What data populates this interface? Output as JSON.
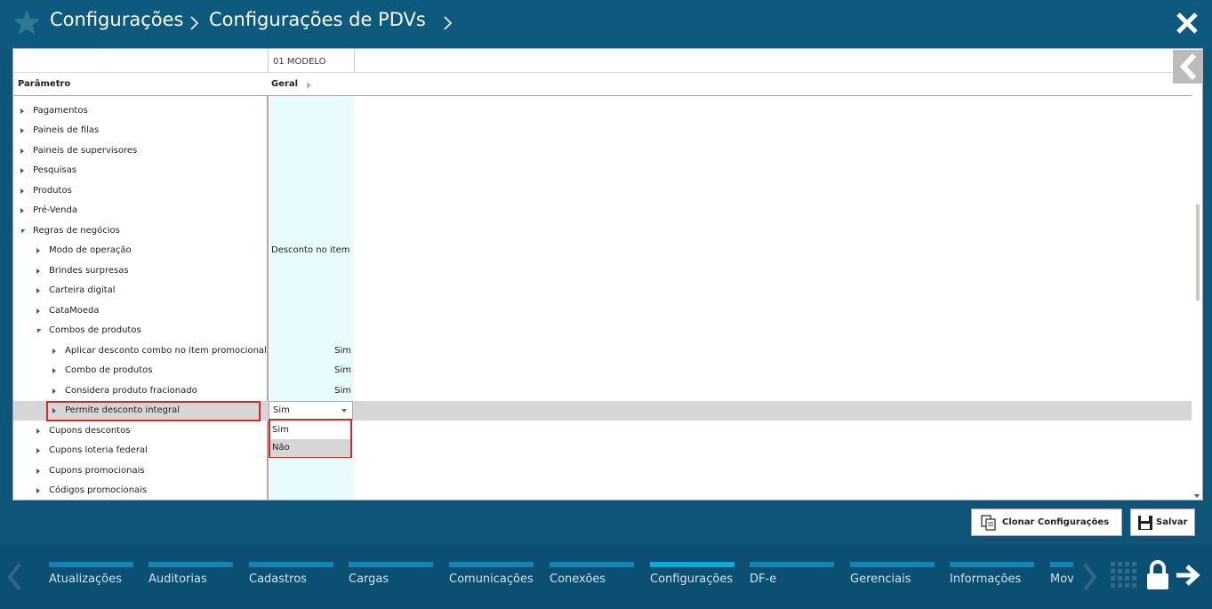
{
  "header": {
    "breadcrumb_1": "Configurações",
    "breadcrumb_2": "Configurações de PDVs"
  },
  "table": {
    "column_group": "01 MODELO",
    "param_header": "Parâmetro",
    "geral_header": "Geral",
    "rows": [
      {
        "label": "Pagamentos",
        "value": ""
      },
      {
        "label": "Paineis de filas",
        "value": ""
      },
      {
        "label": "Paineis de supervisores",
        "value": ""
      },
      {
        "label": "Pesquisas",
        "value": ""
      },
      {
        "label": "Produtos",
        "value": ""
      },
      {
        "label": "Pré-Venda",
        "value": ""
      },
      {
        "label": "Regras de negócios",
        "value": ""
      },
      {
        "label": "Modo de operação",
        "value": "Desconto no item"
      },
      {
        "label": "Brindes surpresas",
        "value": ""
      },
      {
        "label": "Carteira digital",
        "value": ""
      },
      {
        "label": "CataMoeda",
        "value": ""
      },
      {
        "label": "Combos de produtos",
        "value": ""
      },
      {
        "label": "Aplicar desconto combo no item promocional",
        "value": "Sim"
      },
      {
        "label": "Combo de produtos",
        "value": "Sim"
      },
      {
        "label": "Considera produto fracionado",
        "value": "Sim"
      },
      {
        "label": "Permite desconto integral",
        "value": "Sim"
      },
      {
        "label": "Cupons descontos",
        "value": ""
      },
      {
        "label": "Cupons loteria federal",
        "value": ""
      },
      {
        "label": "Cupons promocionais",
        "value": ""
      },
      {
        "label": "Códigos promocionais",
        "value": ""
      }
    ]
  },
  "dropdown": {
    "selected": "Sim",
    "options": [
      "Sim",
      "Não"
    ]
  },
  "buttons": {
    "clone": "Clonar Configurações",
    "save": "Salvar"
  },
  "menu": [
    "Atualizações",
    "Auditorias",
    "Cadastros",
    "Cargas",
    "Comunicações",
    "Conexões",
    "Configurações",
    "DF-e",
    "Gerenciais",
    "Informações",
    "Mov"
  ],
  "menu_active": "Configurações",
  "colors": {
    "header_bg": "#0d5a7e",
    "bottom_bg": "#0b4f72",
    "accent": "#12a6d9",
    "highlight": "#d32a2a",
    "geral_col": "#e8fbfd"
  }
}
